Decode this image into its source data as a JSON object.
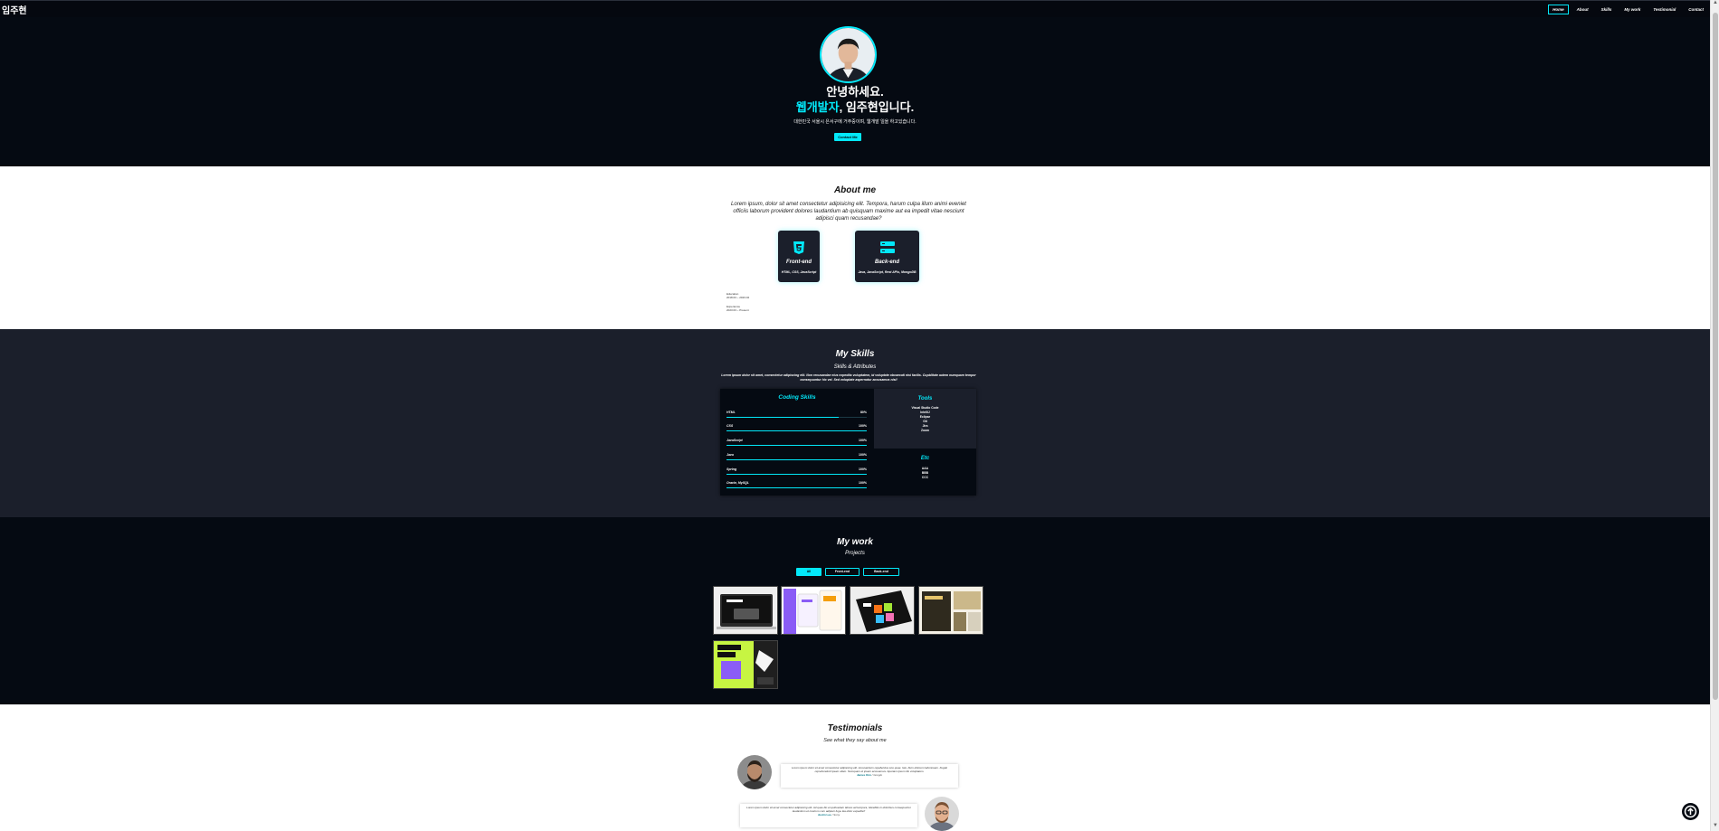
{
  "nav": {
    "logo": "임주현",
    "items": [
      "Home",
      "About",
      "Skills",
      "My work",
      "Testimonial",
      "Contact"
    ],
    "active_index": 0
  },
  "hero": {
    "greeting": "안녕하세요.",
    "highlight": "웹개발자",
    "name_line": ", 임주현입니다.",
    "description": "대한민국 서울시 은서구에 거주중이며, 웹개발 일을 하고있습니다.",
    "contact_button": "Contact Me"
  },
  "about": {
    "title": "About me",
    "description": "Lorem ipsum, dolor sit amet consectetur adipisicing elit. Tempora, harum culpa illum animi eveniet officiis laborum provident dolores laudantium ab quisquam maxime aut ea impedit vitae nesciunt adipisci quam recusandae?",
    "cards": [
      {
        "title": "Front-end",
        "subtitle": "HTML, CSS, JavaScript"
      },
      {
        "title": "Back-end",
        "subtitle": "Java, JavaScript, Rest APIs, MongoDB"
      }
    ],
    "info": [
      {
        "label": "Education",
        "value": "2018.03 ~ 2023.02"
      },
      {
        "label": "Experience",
        "value": "2023.03 ~ Present"
      }
    ]
  },
  "skills": {
    "title": "My Skills",
    "subtitle": "Skills & Attributes",
    "description": "Lorem ipsum dolor sit amet, consectetur adipiscing elit. Non recusandae eius expedita voluptatem, id voluptate obcaecati nisi facilis. Cupiditate autem numquam tempor consequuntur hic vel. Sed voluptate aspernatur accusamus nisi!",
    "coding_title": "Coding Skills",
    "coding": [
      {
        "name": "HTML",
        "percent": "80%",
        "value": 0.8
      },
      {
        "name": "CSS",
        "percent": "100%",
        "value": 1.0
      },
      {
        "name": "JavaScript",
        "percent": "100%",
        "value": 1.0
      },
      {
        "name": "Java",
        "percent": "100%",
        "value": 1.0
      },
      {
        "name": "Spring",
        "percent": "100%",
        "value": 1.0
      },
      {
        "name": "Oracle, MySQL",
        "percent": "100%",
        "value": 1.0
      }
    ],
    "tools_title": "Tools",
    "tools": [
      "Visual Studio Code",
      "IntelliJ",
      "Eclipse",
      "Git",
      "Jira",
      "Zoom"
    ],
    "etc_title": "Etc",
    "etc": [
      "AAA",
      "BBB",
      "CCC"
    ]
  },
  "work": {
    "title": "My work",
    "subtitle": "Projects",
    "filters": [
      "All",
      "Front-end",
      "Back-end"
    ],
    "active_filter": 0
  },
  "testimonials": {
    "title": "Testimonials",
    "subtitle": "See what they say about me",
    "items": [
      {
        "text": "Lorem ipsum dolor sit amet consectetur adipisicing elit. Accusantium repellendus iure quae. Iste, illum dolorem laboriosam. Fugiat reprehenderit ipsam ullam. Numquam et ipsam accusamus. Aperiam ipsum illo voluptatem.",
        "author": "James Kim",
        "company": "/ Google"
      },
      {
        "text": "Lorem ipsum dolor sit amet consectetur adipisicing elit. Ad quas illo et quibusdam labore ad tempora, blanditiis in doloribus consequuntur laudantium et nostrum cum adipisci fuga. Ea dolor expedita?",
        "author": "Justin Lee",
        "company": "/ Sony"
      }
    ]
  },
  "colors": {
    "accent": "#03e8f9",
    "dark": "#050a12",
    "dark_alt": "#1b1f2b"
  }
}
